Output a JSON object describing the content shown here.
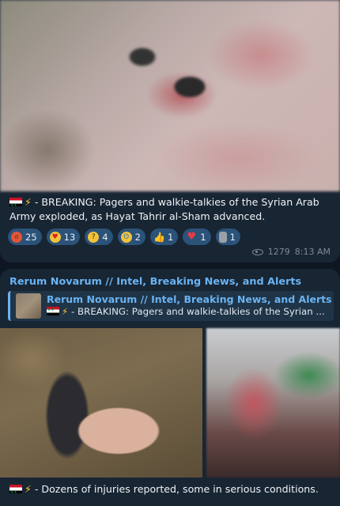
{
  "message1": {
    "caption": "- BREAKING: Pagers and walkie-talkies of the Syrian Arab Army exploded, as Hayat Tahrir al-Sham advanced.",
    "reactions": [
      {
        "emoji": "angry-face",
        "count": "25",
        "color": "#e2553a"
      },
      {
        "emoji": "heart-eyes-face",
        "count": "13",
        "color": "#f3c23a"
      },
      {
        "emoji": "thinking-face",
        "count": "4",
        "color": "#f3c23a"
      },
      {
        "emoji": "crying-face",
        "count": "2",
        "color": "#f3c23a"
      },
      {
        "emoji": "thumbs-up",
        "count": "1",
        "color": "#f3c23a"
      },
      {
        "emoji": "broken-heart",
        "count": "1",
        "color": "#e23b48"
      },
      {
        "emoji": "moai",
        "count": "1",
        "color": "#9aa0a6"
      }
    ],
    "views": "1279",
    "time": "8:13 AM"
  },
  "message2": {
    "channel_name": "Rerum Novarum // Intel, Breaking News, and Alerts",
    "forwarded_title": "Rerum Novarum // Intel, Breaking News, and Alerts",
    "forwarded_text": "- BREAKING: Pagers and walkie-talkies of the Syrian ...",
    "caption": "- Dozens of injuries reported, some in serious conditions."
  },
  "colors": {
    "background": "#0e1621",
    "bubble": "#182533",
    "accent": "#6ab3f3",
    "reaction_bg": "#2b5278"
  }
}
